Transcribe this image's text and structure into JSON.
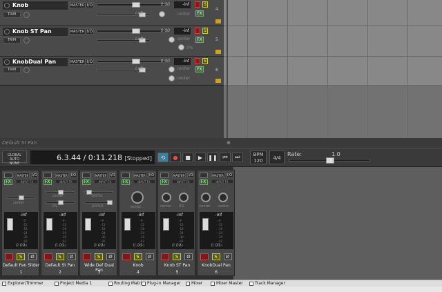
{
  "tracks": [
    {
      "name": "Knob",
      "master": "MASTER",
      "io": "I/O",
      "vol_db": "0.00",
      "peak": "-inf",
      "trim": "TRIM",
      "pan": "Left",
      "pan_label": "center",
      "num": "4",
      "fx": "FX",
      "s": "S"
    },
    {
      "name": "Knob ST Pan",
      "master": "MASTER",
      "io": "I/O",
      "vol_db": "0.00",
      "peak": "-inf",
      "trim": "TRIM",
      "pan": "Left",
      "pan_label": "center",
      "width_label": "0%",
      "num": "5",
      "fx": "FX",
      "s": "S"
    },
    {
      "name": "KnobDual Pan",
      "master": "MASTER",
      "io": "I/O",
      "vol_db": "0.00",
      "peak": "-inf",
      "trim": "TRIM",
      "pan": "Left",
      "pan_label": "center",
      "width_label": "center",
      "num": "6",
      "fx": "FX",
      "s": "S"
    }
  ],
  "status_text": "Default St Pan",
  "transport": {
    "global_auto": "GLOBAL AUTO",
    "global_auto_mode": "NONE",
    "time": "6.3.44 / 0:11.218",
    "state": "[Stopped]",
    "bpm_label": "BPM",
    "bpm": "120",
    "time_sig": "4/4",
    "rate_label": "Rate:",
    "rate": "1.0",
    "rate_position": 0.5,
    "buttons": [
      "⟲",
      "●",
      "■",
      "▶",
      "❚❚",
      "⏮",
      "⏭"
    ]
  },
  "mixer": {
    "strips": [
      {
        "name": "Default Pan Slider",
        "num": "1",
        "master": "MASTER",
        "io": "I/O",
        "input_fx": "INPUT FX",
        "fx": "FX",
        "peak": "-inf",
        "vol_db": "0.00",
        "pan_label": "center",
        "scale": [
          "-6",
          "-12",
          "-18",
          "-24",
          "-30",
          "-42",
          "-54"
        ]
      },
      {
        "name": "Default St Pan",
        "num": "2",
        "master": "MASTER",
        "io": "I/O",
        "input_fx": "INPUT FX",
        "fx": "FX",
        "peak": "-inf",
        "vol_db": "0.00",
        "pan_label": "center",
        "width_label": "0%",
        "scale": [
          "-6",
          "-12",
          "-18",
          "-24",
          "-30",
          "-42",
          "-54"
        ]
      },
      {
        "name": "Wide Def Dual Pan",
        "num": "3",
        "master": "MASTER",
        "io": "I/O",
        "input_fx": "INPUT FX",
        "fx": "FX",
        "peak": "-inf",
        "vol_db": "0.00",
        "pan_label": "100%L",
        "width_label": "100%R",
        "scale": [
          "-6",
          "-12",
          "-18",
          "-24",
          "-30",
          "-42",
          "-54"
        ]
      },
      {
        "name": "Knob",
        "num": "4",
        "master": "MASTER",
        "io": "I/O",
        "input_fx": "INPUT FX",
        "fx": "FX",
        "peak": "-inf",
        "vol_db": "0.00",
        "pan_label": "center",
        "scale": [
          "-6",
          "-12",
          "-18",
          "-24",
          "-30",
          "-42",
          "-54"
        ]
      },
      {
        "name": "Knob ST Pan",
        "num": "5",
        "master": "MASTER",
        "io": "I/O",
        "input_fx": "INPUT FX",
        "fx": "FX",
        "peak": "-inf",
        "vol_db": "0.00",
        "pan_label": "center",
        "width_label": "0%",
        "scale": [
          "-6",
          "-12",
          "-18",
          "-24",
          "-30",
          "-42",
          "-54"
        ]
      },
      {
        "name": "KnobDual Pan",
        "num": "6",
        "master": "MASTER",
        "io": "I/O",
        "input_fx": "INPUT FX",
        "fx": "FX",
        "peak": "-inf",
        "vol_db": "0.00",
        "pan_label": "center",
        "width_label": "center",
        "scale": [
          "-6",
          "-12",
          "-18",
          "-24",
          "-30",
          "-42",
          "-54"
        ]
      }
    ]
  },
  "tabs": [
    "Explorer/Trimmer",
    "Project Media 1",
    "Routing Matrix",
    "Plug-in Manager",
    "Mixer",
    "Mixer Master",
    "Track Manager"
  ]
}
